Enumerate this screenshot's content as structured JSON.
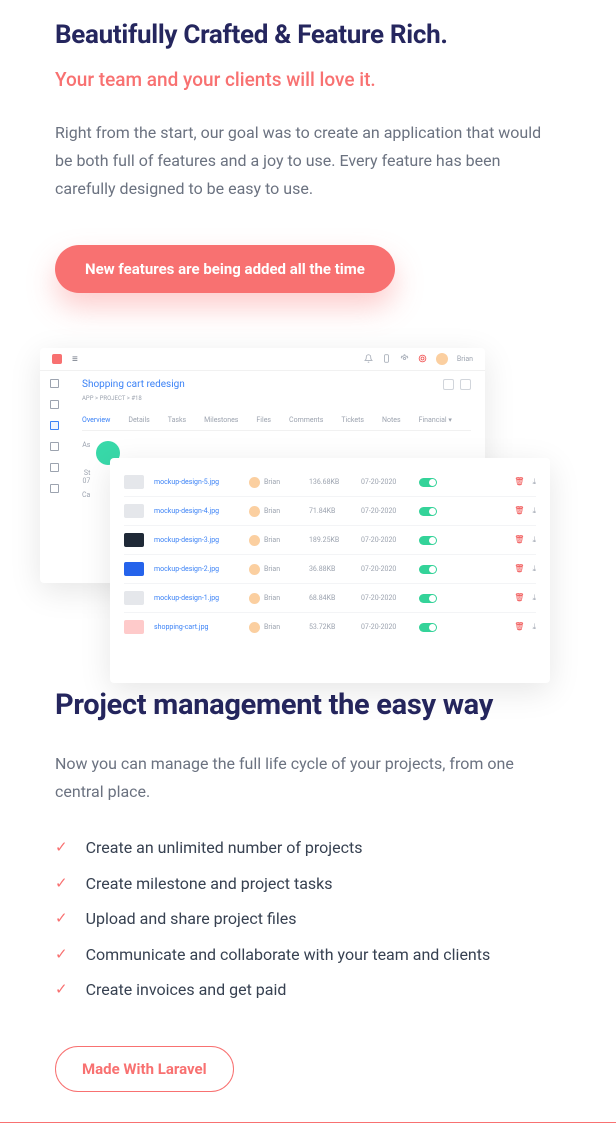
{
  "hero": {
    "title": "Beautifully Crafted & Feature Rich.",
    "subtitle": "Your team and your clients will love it.",
    "body": "Right from the start, our goal was to create an application that would be both full of features and a joy to use. Every feature has been carefully designed to be easy to use.",
    "pill_label": "New features are being added all the time"
  },
  "app": {
    "user_name": "Brian",
    "project_title": "Shopping cart redesign",
    "breadcrumb_app": "APP",
    "breadcrumb_project": "PROJECT",
    "breadcrumb_id": "#18",
    "tabs": [
      "Overview",
      "Details",
      "Tasks",
      "Milestones",
      "Files",
      "Comments",
      "Tickets",
      "Notes",
      "Financial ▾"
    ],
    "truncated": {
      "a": "As",
      "b": "St",
      "c": "07",
      "d": "Ca"
    },
    "files": [
      {
        "name": "mockup-design-5.jpg",
        "user": "Brian",
        "size": "136.68KB",
        "date": "07-20-2020"
      },
      {
        "name": "mockup-design-4.jpg",
        "user": "Brian",
        "size": "71.84KB",
        "date": "07-20-2020"
      },
      {
        "name": "mockup-design-3.jpg",
        "user": "Brian",
        "size": "189.25KB",
        "date": "07-20-2020"
      },
      {
        "name": "mockup-design-2.jpg",
        "user": "Brian",
        "size": "36.88KB",
        "date": "07-20-2020"
      },
      {
        "name": "mockup-design-1.jpg",
        "user": "Brian",
        "size": "68.84KB",
        "date": "07-20-2020"
      },
      {
        "name": "shopping-cart.jpg",
        "user": "Brian",
        "size": "53.72KB",
        "date": "07-20-2020"
      }
    ]
  },
  "pm": {
    "title": "Project management the easy way",
    "lead": "Now you can manage the full life cycle of your projects, from one central place.",
    "items": [
      "Create an unlimited number of projects",
      "Create milestone and project tasks",
      "Upload and share project files",
      "Communicate and collaborate with your team and clients",
      "Create invoices and get paid"
    ],
    "outline_label": "Made With Laravel"
  }
}
